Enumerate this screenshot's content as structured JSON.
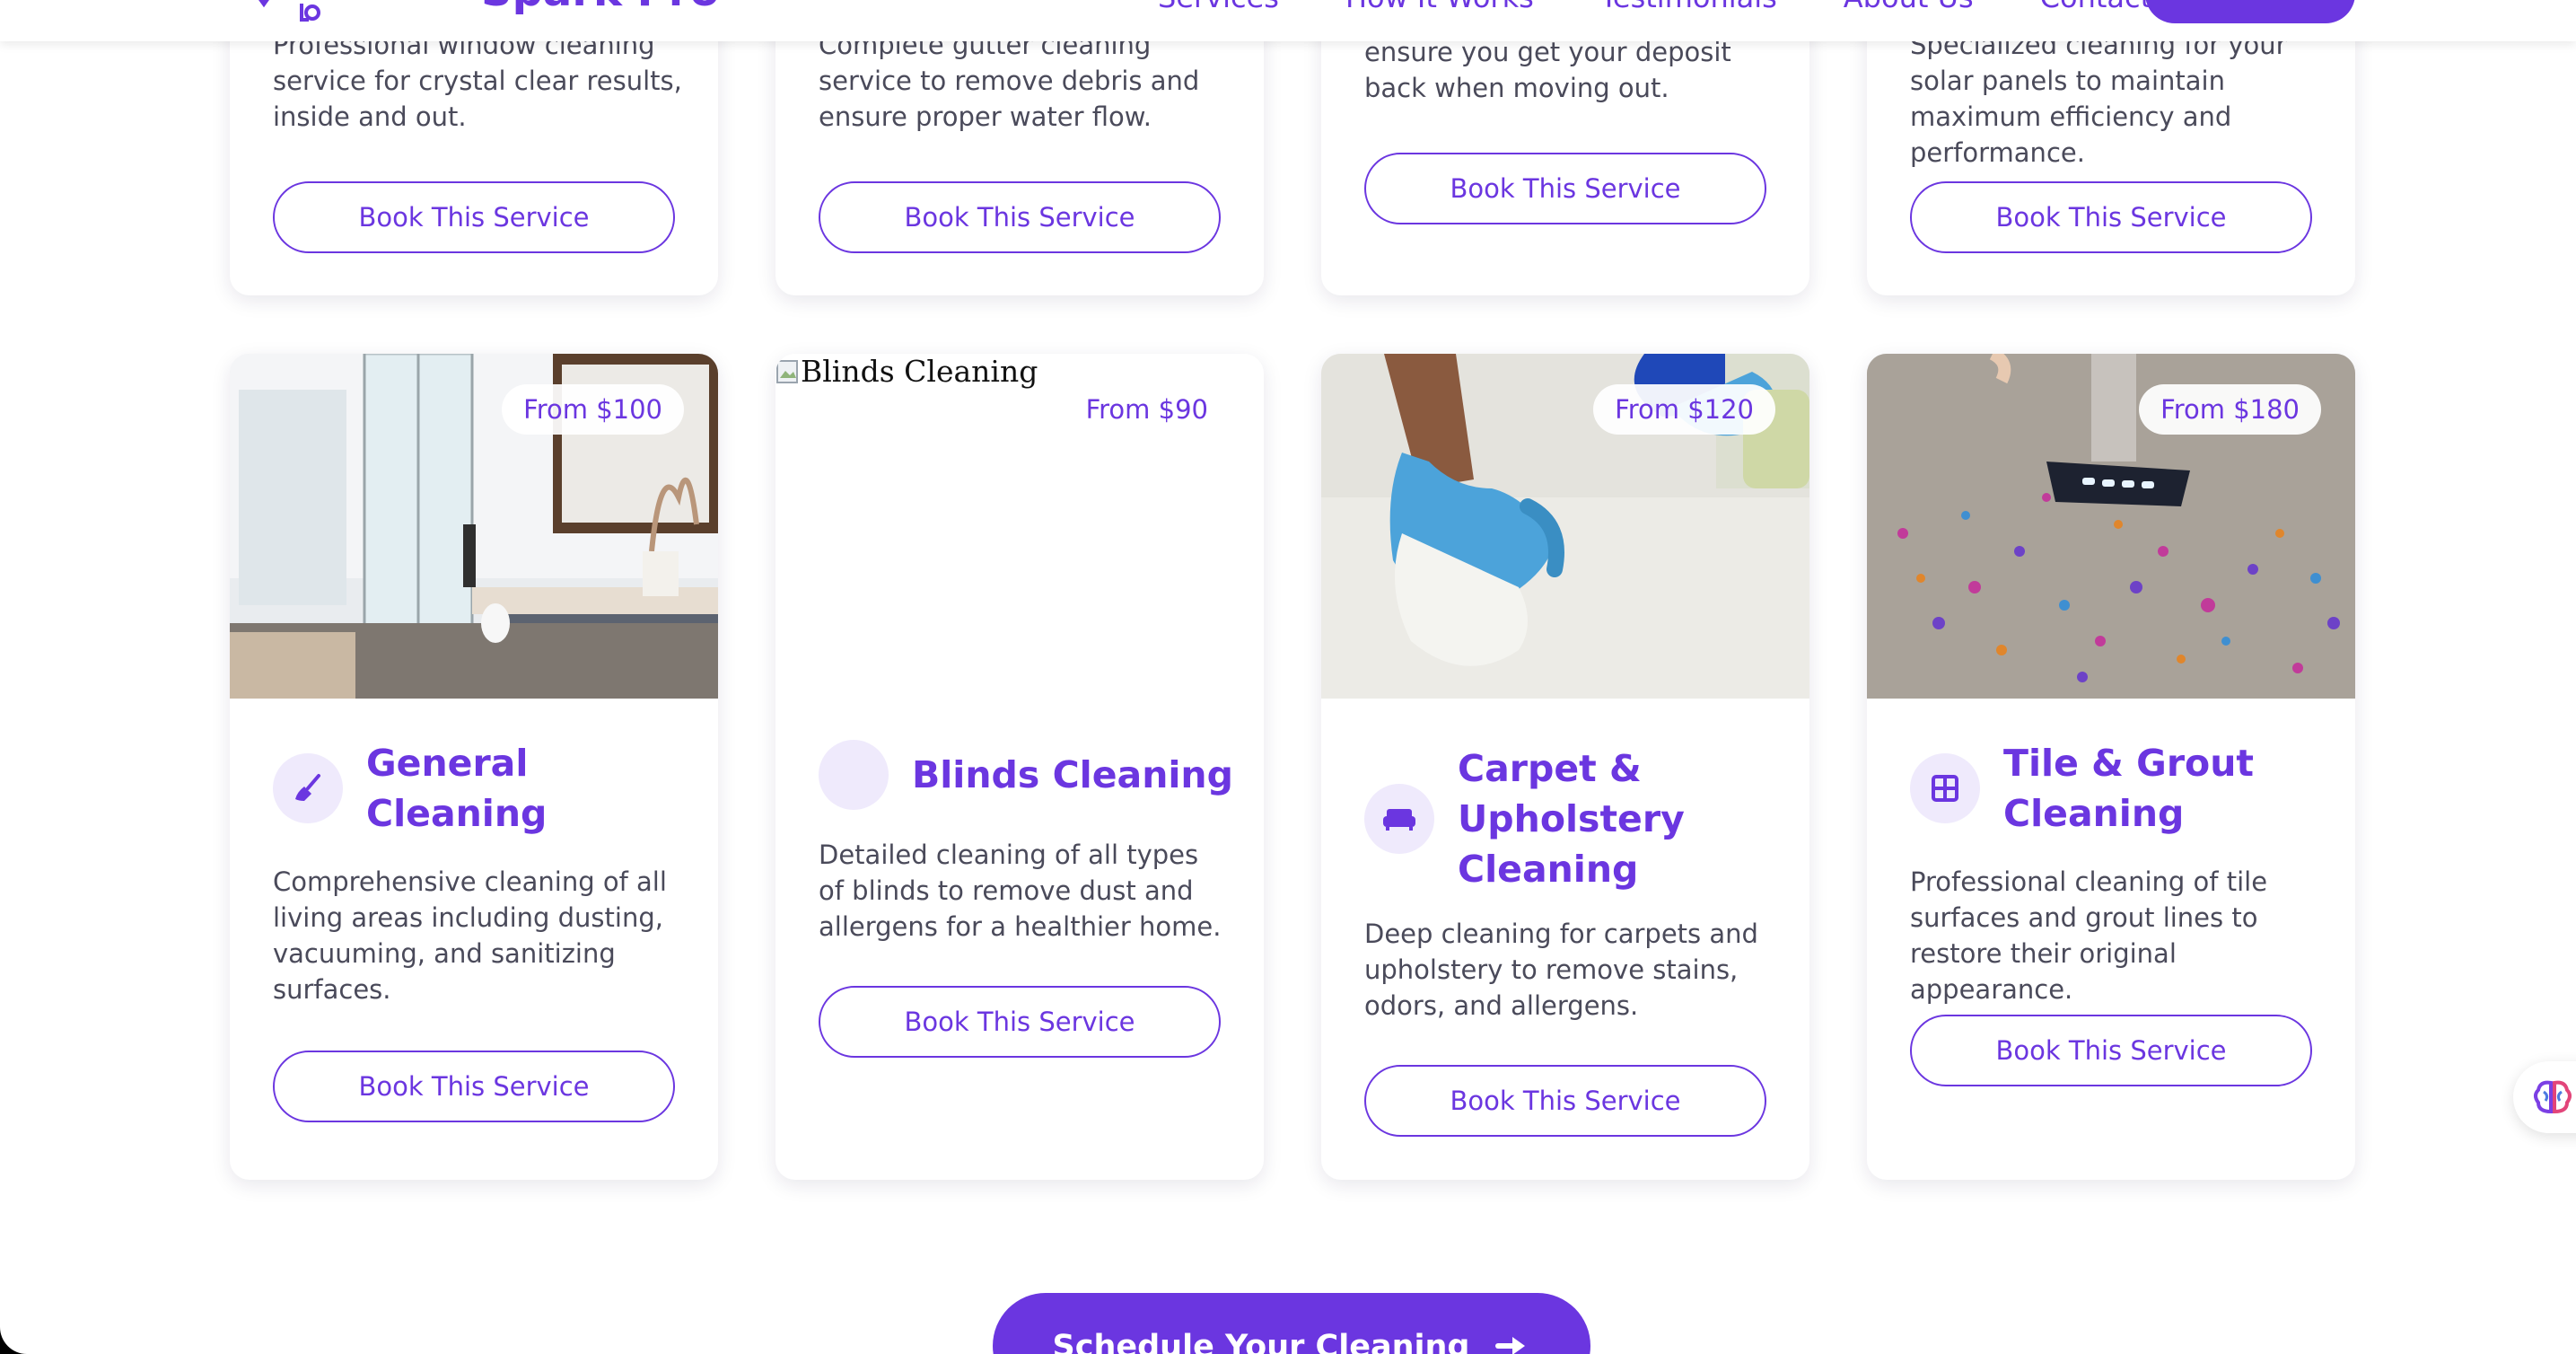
{
  "header": {
    "brand": "Spark Pro",
    "nav": [
      "Services",
      "How It Works",
      "Testimonials",
      "About Us",
      "Contact"
    ]
  },
  "top_cards": [
    {
      "description": "Professional window cleaning service for crystal clear results, inside and out.",
      "button": "Book This Service"
    },
    {
      "description": "Complete gutter cleaning service to remove debris and ensure proper water flow.",
      "button": "Book This Service"
    },
    {
      "description": "ensure you get your deposit back when moving out.",
      "button": "Book This Service"
    },
    {
      "description": "Specialized cleaning for your solar panels to maintain maximum efficiency and performance.",
      "button": "Book This Service"
    }
  ],
  "bottom_cards": [
    {
      "price": "From $100",
      "title": "General Cleaning",
      "icon": "broom-icon",
      "description": "Comprehensive cleaning of all living areas including dusting, vacuuming, and sanitizing surfaces.",
      "button": "Book This Service"
    },
    {
      "price": "From $90",
      "image_alt": "Blinds Cleaning",
      "title": "Blinds Cleaning",
      "icon": "blank-icon",
      "description": "Detailed cleaning of all types of blinds to remove dust and allergens for a healthier home.",
      "button": "Book This Service"
    },
    {
      "price": "From $120",
      "title": "Carpet & Upholstery Cleaning",
      "icon": "couch-icon",
      "description": "Deep cleaning for carpets and upholstery to remove stains, odors, and allergens.",
      "button": "Book This Service"
    },
    {
      "price": "From $180",
      "title": "Tile & Grout Cleaning",
      "icon": "tile-grid-icon",
      "description": "Professional cleaning of tile surfaces and grout lines to restore their original appearance.",
      "button": "Book This Service"
    }
  ],
  "cta": {
    "label": "Schedule Your Cleaning"
  },
  "colors": {
    "accent": "#6b36e0",
    "icon_bg": "#efeafc",
    "text": "#4a4a5a"
  }
}
